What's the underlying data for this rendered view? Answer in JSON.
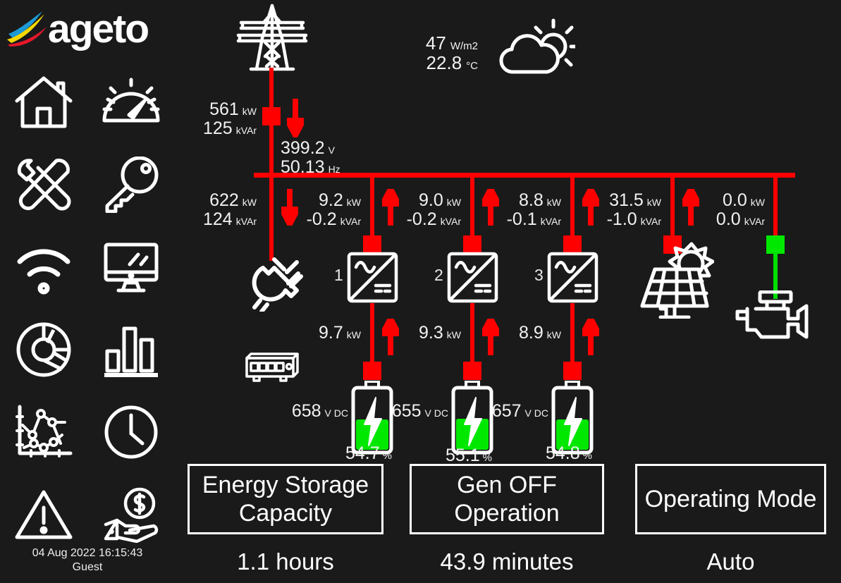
{
  "brand": {
    "name": "ageto"
  },
  "sidebar": {
    "icons": [
      {
        "name": "home-icon",
        "label": "Home"
      },
      {
        "name": "gauge-icon",
        "label": "Dashboard"
      },
      {
        "name": "tools-icon",
        "label": "Maintenance"
      },
      {
        "name": "key-icon",
        "label": "Access"
      },
      {
        "name": "wifi-icon",
        "label": "Network"
      },
      {
        "name": "monitor-icon",
        "label": "Display"
      },
      {
        "name": "pie-chart-icon",
        "label": "Distribution"
      },
      {
        "name": "bar-chart-icon",
        "label": "Statistics"
      },
      {
        "name": "line-chart-icon",
        "label": "Trends"
      },
      {
        "name": "clock-icon",
        "label": "History"
      },
      {
        "name": "alarm-warning-icon",
        "label": "Alarms"
      },
      {
        "name": "cost-hand-icon",
        "label": "Cost"
      }
    ],
    "datetime": "04 Aug 2022 16:15:43",
    "user": "Guest"
  },
  "weather": {
    "irradiance": "47",
    "irradiance_unit": "W/m2",
    "temperature": "22.8",
    "temperature_unit": "°C",
    "icon": "partly-cloudy-icon"
  },
  "utility": {
    "icon": "transmission-tower-icon",
    "kw": "561",
    "kw_unit": "kW",
    "kvar": "125",
    "kvar_unit": "kVAr",
    "breaker_state": "closed-red",
    "flow": "down"
  },
  "bus": {
    "voltage": "399.2",
    "voltage_unit": "V",
    "frequency": "50.13",
    "frequency_unit": "Hz"
  },
  "load": {
    "icon": "plug-icon",
    "kw": "622",
    "kw_unit": "kW",
    "kvar": "124",
    "kvar_unit": "kVAr",
    "flow": "down"
  },
  "inverters": [
    {
      "number": "1",
      "kw": "9.2",
      "kw_unit": "kW",
      "kvar": "-0.2",
      "kvar_unit": "kVAr",
      "flow": "up",
      "breaker_state": "closed-red",
      "dc_kw": "9.7",
      "dc_kw_unit": "kW",
      "dc_flow": "up",
      "battery": {
        "voltage": "658",
        "voltage_unit": "V DC",
        "soc": "54.7",
        "soc_unit": "%",
        "fill_pct": 54.7,
        "breaker_state": "closed-red"
      }
    },
    {
      "number": "2",
      "kw": "9.0",
      "kw_unit": "kW",
      "kvar": "-0.2",
      "kvar_unit": "kVAr",
      "flow": "up",
      "breaker_state": "closed-red",
      "dc_kw": "9.3",
      "dc_kw_unit": "kW",
      "dc_flow": "up",
      "battery": {
        "voltage": "655",
        "voltage_unit": "V DC",
        "soc": "55.1",
        "soc_unit": "%",
        "fill_pct": 55.1,
        "breaker_state": "closed-red"
      }
    },
    {
      "number": "3",
      "kw": "8.8",
      "kw_unit": "kW",
      "kvar": "-0.1",
      "kvar_unit": "kVAr",
      "flow": "up",
      "breaker_state": "closed-red",
      "dc_kw": "8.9",
      "dc_kw_unit": "kW",
      "dc_flow": "up",
      "battery": {
        "voltage": "657",
        "voltage_unit": "V DC",
        "soc": "54.8",
        "soc_unit": "%",
        "fill_pct": 54.8,
        "breaker_state": "closed-red"
      }
    }
  ],
  "pv": {
    "icon": "solar-panel-icon",
    "kw": "31.5",
    "kw_unit": "kW",
    "kvar": "-1.0",
    "kvar_unit": "kVAr",
    "flow": "up",
    "breaker_state": "closed-red"
  },
  "generator": {
    "icon": "engine-icon",
    "kw": "0.0",
    "kw_unit": "kW",
    "kvar": "0.0",
    "kvar_unit": "kVAr",
    "flow": "none",
    "breaker_state": "open-green"
  },
  "controller": {
    "icon": "network-switch-icon"
  },
  "status_panels": [
    {
      "title_line1": "Energy Storage",
      "title_line2": "Capacity",
      "value": "1.1 hours"
    },
    {
      "title_line1": "Gen OFF",
      "title_line2": "Operation",
      "value": "43.9 minutes"
    },
    {
      "title_line1": "Operating Mode",
      "title_line2": "",
      "value": "Auto"
    }
  ],
  "colors": {
    "background": "#1a1a1a",
    "line_energized": "#ff0000",
    "line_deenergized": "#00e800",
    "foreground": "#f2f2f2",
    "battery_fill": "#00e800"
  }
}
